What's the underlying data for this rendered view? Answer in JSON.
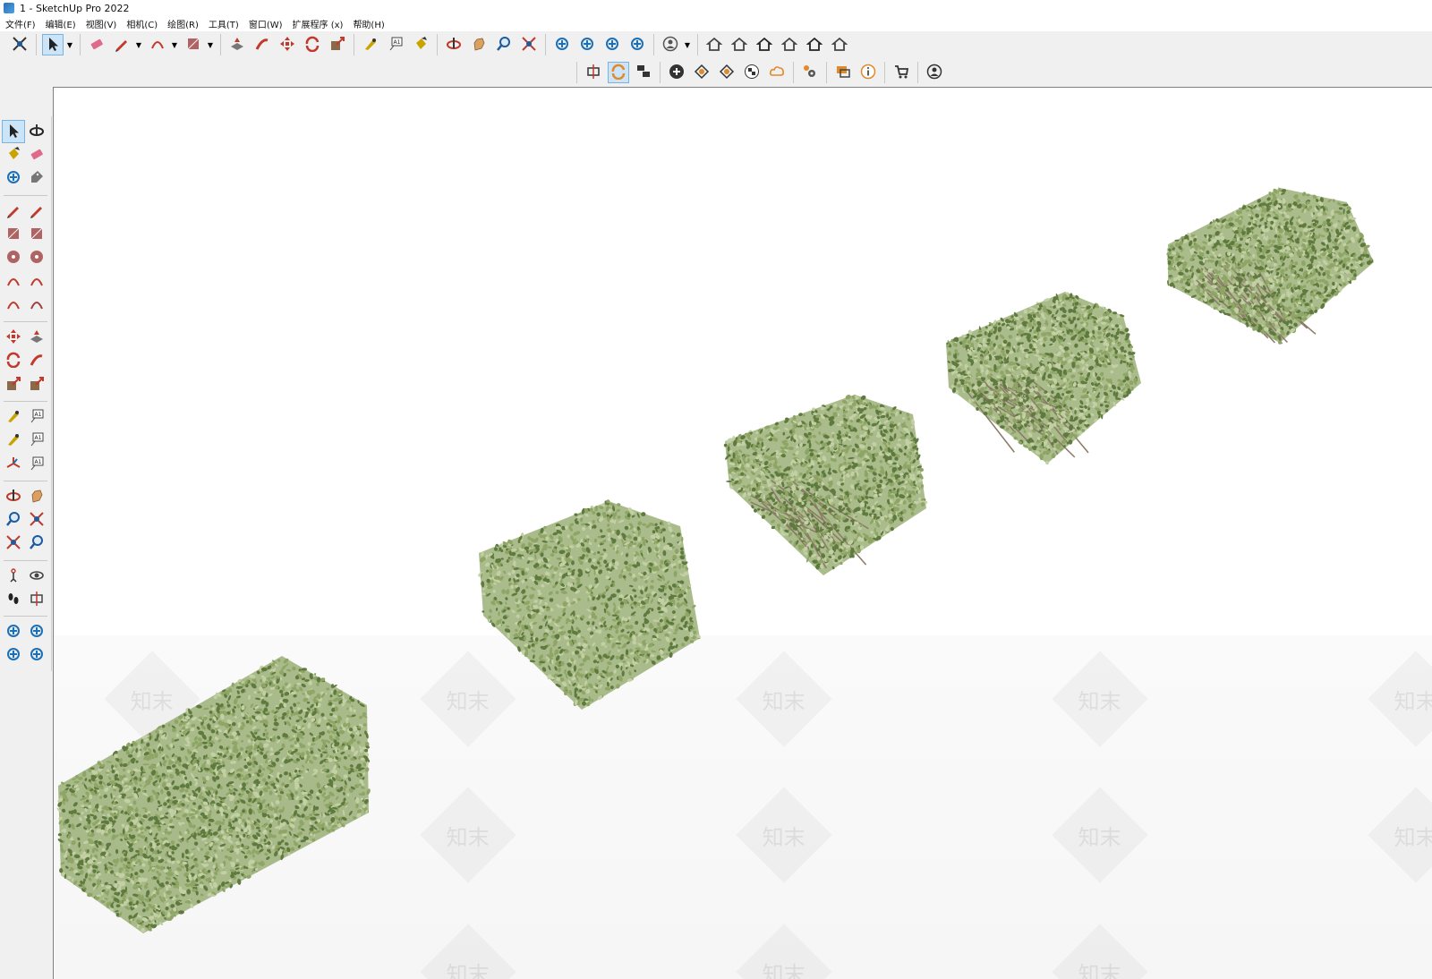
{
  "window": {
    "title": "1 - SketchUp Pro 2022"
  },
  "menus": [
    "文件(F)",
    "编辑(E)",
    "视图(V)",
    "相机(C)",
    "绘图(R)",
    "工具(T)",
    "窗口(W)",
    "扩展程序 (x)",
    "帮助(H)"
  ],
  "toolbar_main": [
    {
      "name": "zoom-extents-icon",
      "color": "#333"
    },
    {
      "name": "select-icon",
      "color": "#222",
      "active": true,
      "caret": true
    },
    {
      "name": "eraser-icon",
      "color": "#e06a8a"
    },
    {
      "name": "pencil-icon",
      "color": "#c0392b",
      "caret": true
    },
    {
      "name": "arc-icon",
      "color": "#c0392b",
      "caret": true
    },
    {
      "name": "rectangle-icon",
      "color": "#a04040",
      "caret": true
    },
    {
      "name": "push-pull-icon",
      "color": "#c0392b"
    },
    {
      "name": "follow-me-icon",
      "color": "#c0392b"
    },
    {
      "name": "move-icon",
      "color": "#c0392b"
    },
    {
      "name": "rotate-icon",
      "color": "#c0392b"
    },
    {
      "name": "scale-icon",
      "color": "#c0392b"
    },
    {
      "name": "tape-measure-icon",
      "color": "#c9a400"
    },
    {
      "name": "text-icon",
      "color": "#444"
    },
    {
      "name": "paint-bucket-icon",
      "color": "#c9a400"
    },
    {
      "name": "orbit-icon",
      "color": "#c0392b"
    },
    {
      "name": "pan-icon",
      "color": "#d9a060"
    },
    {
      "name": "zoom-icon",
      "color": "#1e5a9c"
    },
    {
      "name": "zoom-window-icon",
      "color": "#c0392b"
    },
    {
      "name": "warehouse-icon",
      "color": "#1e6fb3"
    },
    {
      "name": "extension-warehouse-icon",
      "color": "#1e6fb3"
    },
    {
      "name": "layout-icon",
      "color": "#1e6fb3"
    },
    {
      "name": "extension-manager-icon",
      "color": "#1e6fb3"
    },
    {
      "name": "user-account-icon",
      "color": "#555",
      "caret": true
    },
    {
      "name": "iso-view-icon",
      "color": "#444"
    },
    {
      "name": "front-view-icon",
      "color": "#444"
    },
    {
      "name": "home-icon",
      "color": "#222"
    },
    {
      "name": "top-view-icon",
      "color": "#444"
    },
    {
      "name": "house-outline-icon",
      "color": "#222"
    },
    {
      "name": "side-view-icon",
      "color": "#444"
    }
  ],
  "toolbar_secondary": [
    {
      "name": "section-plane-icon",
      "color": "#333"
    },
    {
      "name": "sync-icon",
      "color": "#e08a2a",
      "active": true
    },
    {
      "name": "scenes-icon",
      "color": "#333"
    },
    {
      "name": "add-location-icon",
      "color": "#333"
    },
    {
      "name": "geo-location-icon",
      "color": "#e08a2a"
    },
    {
      "name": "shadow-icon",
      "color": "#e08a2a"
    },
    {
      "name": "checker-icon",
      "color": "#333"
    },
    {
      "name": "cloud-icon",
      "color": "#e08a2a"
    },
    {
      "name": "settings-icon",
      "color": "#e08a2a"
    },
    {
      "name": "chat-icon",
      "color": "#e08a2a"
    },
    {
      "name": "info-icon",
      "color": "#e08a2a"
    },
    {
      "name": "cart-icon",
      "color": "#333"
    },
    {
      "name": "profile-icon",
      "color": "#333"
    }
  ],
  "left_palette": [
    [
      {
        "name": "select-icon",
        "color": "#222",
        "active": true
      },
      {
        "name": "orbit-icon",
        "color": "#222"
      }
    ],
    [
      {
        "name": "paint-bucket-icon",
        "color": "#c9a400"
      },
      {
        "name": "eraser-icon",
        "color": "#e06a8a"
      }
    ],
    [
      {
        "name": "component-icon",
        "color": "#1e6fb3"
      },
      {
        "name": "tag-icon",
        "color": "#777"
      }
    ],
    "sep",
    [
      {
        "name": "pencil-icon",
        "color": "#c0392b"
      },
      {
        "name": "freehand-icon",
        "color": "#c0392b"
      }
    ],
    [
      {
        "name": "rectangle-icon",
        "color": "#a04040"
      },
      {
        "name": "rotated-rectangle-icon",
        "color": "#a04040"
      }
    ],
    [
      {
        "name": "circle-icon",
        "color": "#a04040"
      },
      {
        "name": "polygon-icon",
        "color": "#a04040"
      }
    ],
    [
      {
        "name": "arc-icon",
        "color": "#c0392b"
      },
      {
        "name": "two-point-arc-icon",
        "color": "#c0392b"
      }
    ],
    [
      {
        "name": "three-point-arc-icon",
        "color": "#c0392b"
      },
      {
        "name": "pie-icon",
        "color": "#a04040"
      }
    ],
    "sep",
    [
      {
        "name": "move-icon",
        "color": "#c0392b"
      },
      {
        "name": "push-pull-icon",
        "color": "#c0392b"
      }
    ],
    [
      {
        "name": "rotate-icon",
        "color": "#c0392b"
      },
      {
        "name": "follow-me-icon",
        "color": "#c0392b"
      }
    ],
    [
      {
        "name": "scale-icon",
        "color": "#c0392b"
      },
      {
        "name": "offset-icon",
        "color": "#c0392b"
      }
    ],
    "sep",
    [
      {
        "name": "tape-measure-icon",
        "color": "#c9a400"
      },
      {
        "name": "dimension-icon",
        "color": "#444"
      }
    ],
    [
      {
        "name": "protractor-icon",
        "color": "#c9a400"
      },
      {
        "name": "text-icon",
        "color": "#444"
      }
    ],
    [
      {
        "name": "axes-icon",
        "color": "#c0392b"
      },
      {
        "name": "3d-text-icon",
        "color": "#444"
      }
    ],
    "sep",
    [
      {
        "name": "orbit-icon",
        "color": "#c0392b"
      },
      {
        "name": "pan-icon",
        "color": "#d9a060"
      }
    ],
    [
      {
        "name": "zoom-icon",
        "color": "#1e5a9c"
      },
      {
        "name": "zoom-window-icon",
        "color": "#c0392b"
      }
    ],
    [
      {
        "name": "zoom-extents-icon",
        "color": "#c0392b"
      },
      {
        "name": "previous-view-icon",
        "color": "#1e5a9c"
      }
    ],
    "sep",
    [
      {
        "name": "position-camera-icon",
        "color": "#c0392b"
      },
      {
        "name": "look-around-icon",
        "color": "#444"
      }
    ],
    [
      {
        "name": "walk-icon",
        "color": "#222"
      },
      {
        "name": "section-plane-icon",
        "color": "#444"
      }
    ],
    "sep",
    [
      {
        "name": "warehouse-icon",
        "color": "#1e6fb3"
      },
      {
        "name": "extension-warehouse-icon",
        "color": "#1e6fb3"
      }
    ],
    [
      {
        "name": "layout-icon",
        "color": "#1e6fb3"
      },
      {
        "name": "extension-manager-icon",
        "color": "#1e6fb3"
      }
    ]
  ],
  "watermark_text": "知末",
  "colors": {
    "hedge_dark": "#5f7a3e",
    "hedge_mid": "#8ea565",
    "hedge_light": "#c3d0a4",
    "branch": "#8a7a66",
    "active_tool_bg": "#cce4f7"
  }
}
